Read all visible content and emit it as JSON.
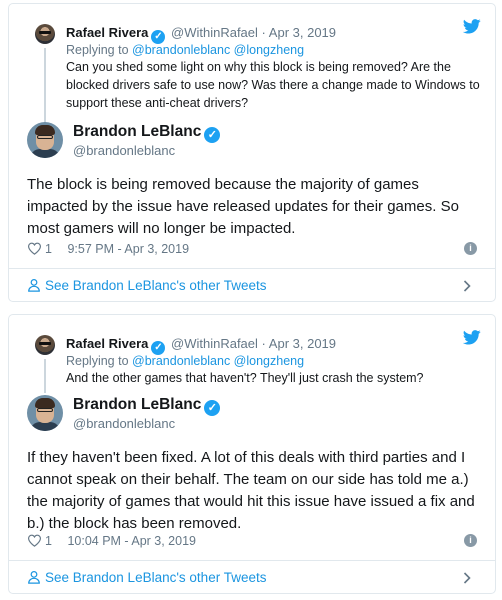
{
  "tweets": [
    {
      "parent": {
        "name": "Rafael Rivera",
        "handle": "@WithinRafael",
        "separator": "·",
        "date": "Apr 3, 2019",
        "replying_prefix": "Replying to",
        "replying_to": "@brandonleblanc @longzheng",
        "text": "Can you shed some light on why this block is being removed? Are the blocked drivers safe to use now? Was there a change made to Windows to support these anti-cheat drivers?"
      },
      "main": {
        "name": "Brandon LeBlanc",
        "handle": "@brandonleblanc",
        "text": "The block is being removed because the majority of games impacted by the issue have released updates for their games. So most gamers will no longer be impacted.",
        "likes": "1",
        "timestamp": "9:57 PM - Apr 3, 2019"
      },
      "footer_label": "See Brandon LeBlanc's other Tweets"
    },
    {
      "parent": {
        "name": "Rafael Rivera",
        "handle": "@WithinRafael",
        "separator": "·",
        "date": "Apr 3, 2019",
        "replying_prefix": "Replying to",
        "replying_to": "@brandonleblanc @longzheng",
        "text": "And the other games that haven't? They'll just crash the system?"
      },
      "main": {
        "name": "Brandon LeBlanc",
        "handle": "@brandonleblanc",
        "text": "If they haven't been fixed. A lot of this deals with third parties and I cannot speak on their behalf. The team on our side has told me a.) the majority of games that would hit this issue have issued a fix and b.) the block has been removed.",
        "likes": "1",
        "timestamp": "10:04 PM - Apr 3, 2019"
      },
      "footer_label": "See Brandon LeBlanc's other Tweets"
    }
  ],
  "icons": {
    "brand": "twitter-bird-icon",
    "verified": "verified-badge-icon",
    "like": "heart-icon",
    "info": "info-icon",
    "profile": "user-icon",
    "chevron": "chevron-right-icon"
  },
  "colors": {
    "accent": "#1da1f2",
    "link": "#1b95e0",
    "text": "#14171a",
    "muted": "#657786",
    "border": "#e1e8ed"
  }
}
